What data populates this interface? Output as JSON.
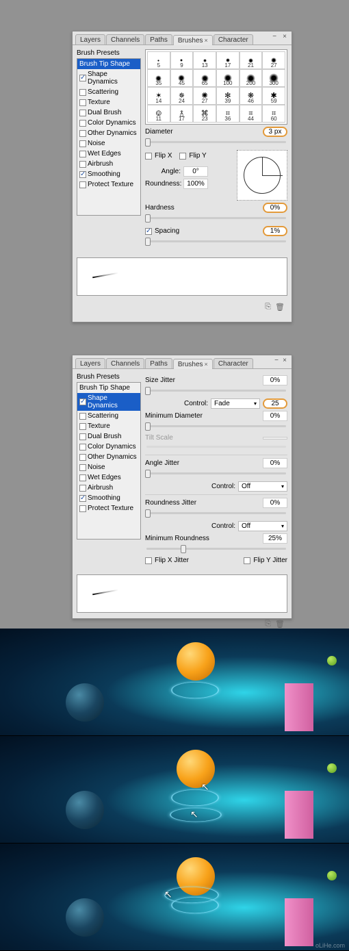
{
  "tabs": [
    "Layers",
    "Channels",
    "Paths",
    "Brushes",
    "Character"
  ],
  "activeTab": "Brushes",
  "presetsLabel": "Brush Presets",
  "checklist": [
    {
      "label": "Brush Tip Shape",
      "checkbox": false,
      "checked": false
    },
    {
      "label": "Shape Dynamics",
      "checkbox": true,
      "checked": true
    },
    {
      "label": "Scattering",
      "checkbox": true,
      "checked": false
    },
    {
      "label": "Texture",
      "checkbox": true,
      "checked": false
    },
    {
      "label": "Dual Brush",
      "checkbox": true,
      "checked": false
    },
    {
      "label": "Color Dynamics",
      "checkbox": true,
      "checked": false
    },
    {
      "label": "Other Dynamics",
      "checkbox": true,
      "checked": false
    },
    {
      "label": "Noise",
      "checkbox": true,
      "checked": false
    },
    {
      "label": "Wet Edges",
      "checkbox": true,
      "checked": false
    },
    {
      "label": "Airbrush",
      "checkbox": true,
      "checked": false
    },
    {
      "label": "Smoothing",
      "checkbox": true,
      "checked": true
    },
    {
      "label": "Protect Texture",
      "checkbox": true,
      "checked": false
    }
  ],
  "panel1": {
    "selectedItem": "Brush Tip Shape",
    "swatchRows": [
      [
        "5",
        "9",
        "13",
        "17",
        "21",
        "27"
      ],
      [
        "35",
        "45",
        "65",
        "100",
        "200",
        "300"
      ],
      [
        "14",
        "24",
        "27",
        "39",
        "46",
        "59"
      ],
      [
        "11",
        "17",
        "23",
        "36",
        "44",
        "60"
      ]
    ],
    "diameterLabel": "Diameter",
    "diameterValue": "3 px",
    "flipX": "Flip X",
    "flipY": "Flip Y",
    "angleLabel": "Angle:",
    "angleValue": "0°",
    "roundnessLabel": "Roundness:",
    "roundnessValue": "100%",
    "hardnessLabel": "Hardness",
    "hardnessValue": "0%",
    "spacingLabel": "Spacing",
    "spacingValue": "1%"
  },
  "panel2": {
    "selectedItem": "Shape Dynamics",
    "sizeJitterLabel": "Size Jitter",
    "sizeJitterValue": "0%",
    "controlLabel": "Control:",
    "sizeControl": "Fade",
    "sizeControlVal": "25",
    "minDiameterLabel": "Minimum Diameter",
    "minDiameterValue": "0%",
    "tiltScaleLabel": "Tilt Scale",
    "angleJitterLabel": "Angle Jitter",
    "angleJitterValue": "0%",
    "angleControl": "Off",
    "roundnessJitterLabel": "Roundness Jitter",
    "roundnessJitterValue": "0%",
    "roundnessControl": "Off",
    "minRoundnessLabel": "Minimum Roundness",
    "minRoundnessValue": "25%",
    "flipXJitter": "Flip X Jitter",
    "flipYJitter": "Flip Y Jitter"
  },
  "watermark": "oLiHe.com"
}
